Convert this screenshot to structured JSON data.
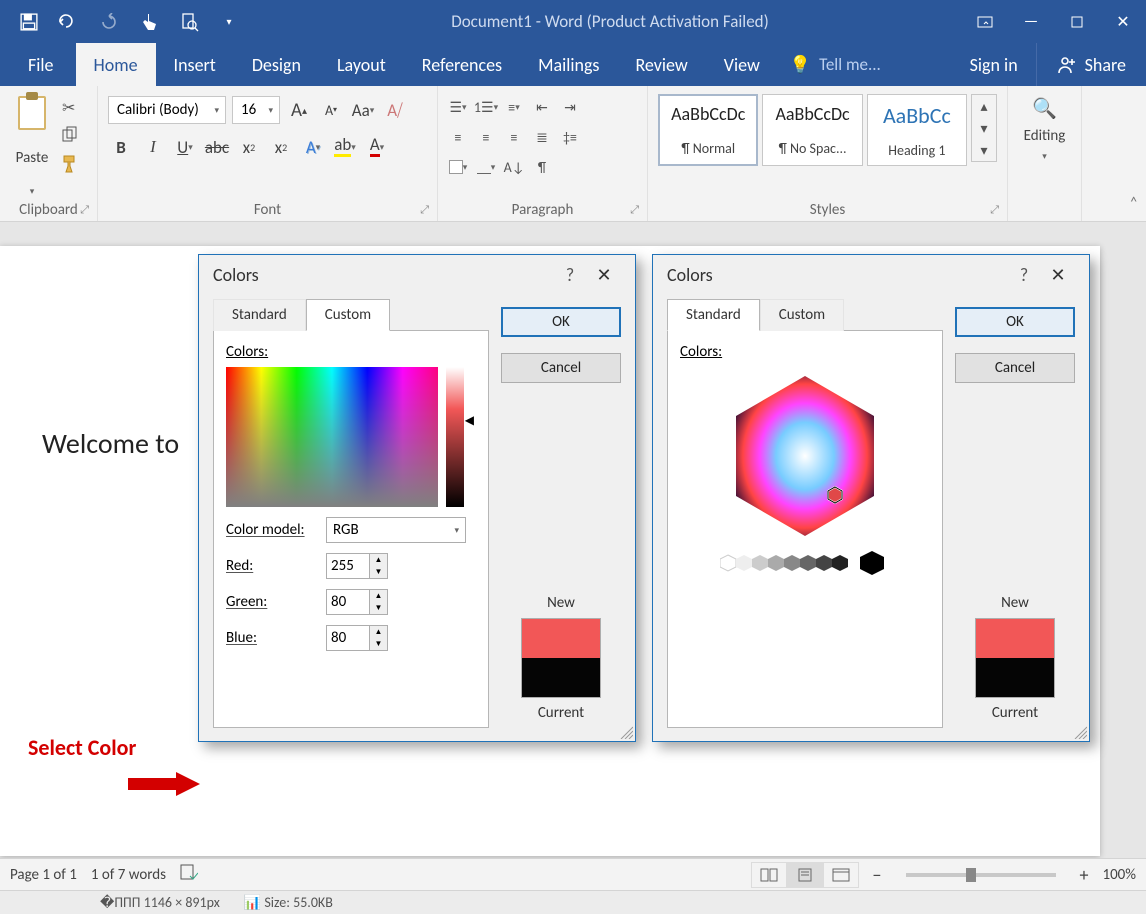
{
  "titlebar": {
    "title": "Document1 - Word (Product Activation Failed)"
  },
  "tabs": {
    "file": "File",
    "home": "Home",
    "insert": "Insert",
    "design": "Design",
    "layout": "Layout",
    "references": "References",
    "mailings": "Mailings",
    "review": "Review",
    "view": "View",
    "tellme": "Tell me...",
    "signin": "Sign in",
    "share": "Share"
  },
  "ribbon": {
    "clipboard": {
      "paste": "Paste",
      "label": "Clipboard"
    },
    "font": {
      "name": "Calibri (Body)",
      "size": "16",
      "label": "Font"
    },
    "paragraph": {
      "label": "Paragraph"
    },
    "styles": {
      "label": "Styles",
      "sample": "AaBbCcDc",
      "sample_h1": "AaBbCc",
      "normal": "¶ Normal",
      "nospace": "¶ No Spac...",
      "heading1": "Heading 1"
    },
    "editing": {
      "label": "Editing"
    }
  },
  "document": {
    "text": "Welcome to",
    "annotation": "Select Color"
  },
  "dialog": {
    "title": "Colors",
    "help": "?",
    "tab_standard": "Standard",
    "tab_custom": "Custom",
    "colors_label": "Colors:",
    "colormodel_label": "Color model:",
    "colormodel_value": "RGB",
    "red_label": "Red:",
    "red_value": "255",
    "green_label": "Green:",
    "green_value": "80",
    "blue_label": "Blue:",
    "blue_value": "80",
    "ok": "OK",
    "cancel": "Cancel",
    "new": "New",
    "current": "Current",
    "swatch_new_color": "#f25757",
    "swatch_current_color": "#050505"
  },
  "status": {
    "page": "Page 1 of 1",
    "words": "1 of 7 words",
    "zoom": "100%"
  },
  "footer": {
    "dims": "1146 × 891px",
    "size": "Size: 55.0KB"
  }
}
